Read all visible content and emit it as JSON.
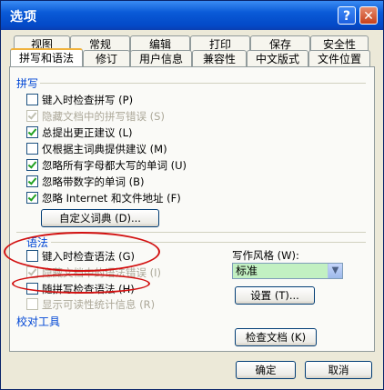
{
  "window": {
    "title": "选项",
    "help_label": "?",
    "close_label": "✕"
  },
  "tabs_row1": [
    "视图",
    "常规",
    "编辑",
    "打印",
    "保存",
    "安全性"
  ],
  "tabs_row2": [
    "拼写和语法",
    "修订",
    "用户信息",
    "兼容性",
    "中文版式",
    "文件位置"
  ],
  "spelling": {
    "heading": "拼写",
    "options": [
      {
        "label": "键入时检查拼写 (P)",
        "checked": false,
        "disabled": false
      },
      {
        "label": "隐藏文档中的拼写错误 (S)",
        "checked": true,
        "disabled": true
      },
      {
        "label": "总提出更正建议 (L)",
        "checked": true,
        "disabled": false
      },
      {
        "label": "仅根据主词典提供建议 (M)",
        "checked": false,
        "disabled": false
      },
      {
        "label": "忽略所有字母都大写的单词 (U)",
        "checked": true,
        "disabled": false
      },
      {
        "label": "忽略带数字的单词 (B)",
        "checked": true,
        "disabled": false
      },
      {
        "label": "忽略 Internet 和文件地址 (F)",
        "checked": true,
        "disabled": false
      }
    ],
    "custom_dict_button": "自定义词典 (D)..."
  },
  "grammar": {
    "heading": "语法",
    "options": [
      {
        "label": "键入时检查语法 (G)",
        "checked": false,
        "disabled": false
      },
      {
        "label": "隐藏文档中的语法错误 (I)",
        "checked": true,
        "disabled": true
      },
      {
        "label": "随拼写检查语法 (H)",
        "checked": false,
        "disabled": false
      },
      {
        "label": "显示可读性统计信息 (R)",
        "checked": false,
        "disabled": true
      }
    ],
    "style_label": "写作风格 (W):",
    "style_value": "标准",
    "settings_button": "设置 (T)..."
  },
  "proofing": {
    "heading": "校对工具",
    "check_doc_button": "检查文档 (K)"
  },
  "footer": {
    "ok": "确定",
    "cancel": "取消"
  }
}
